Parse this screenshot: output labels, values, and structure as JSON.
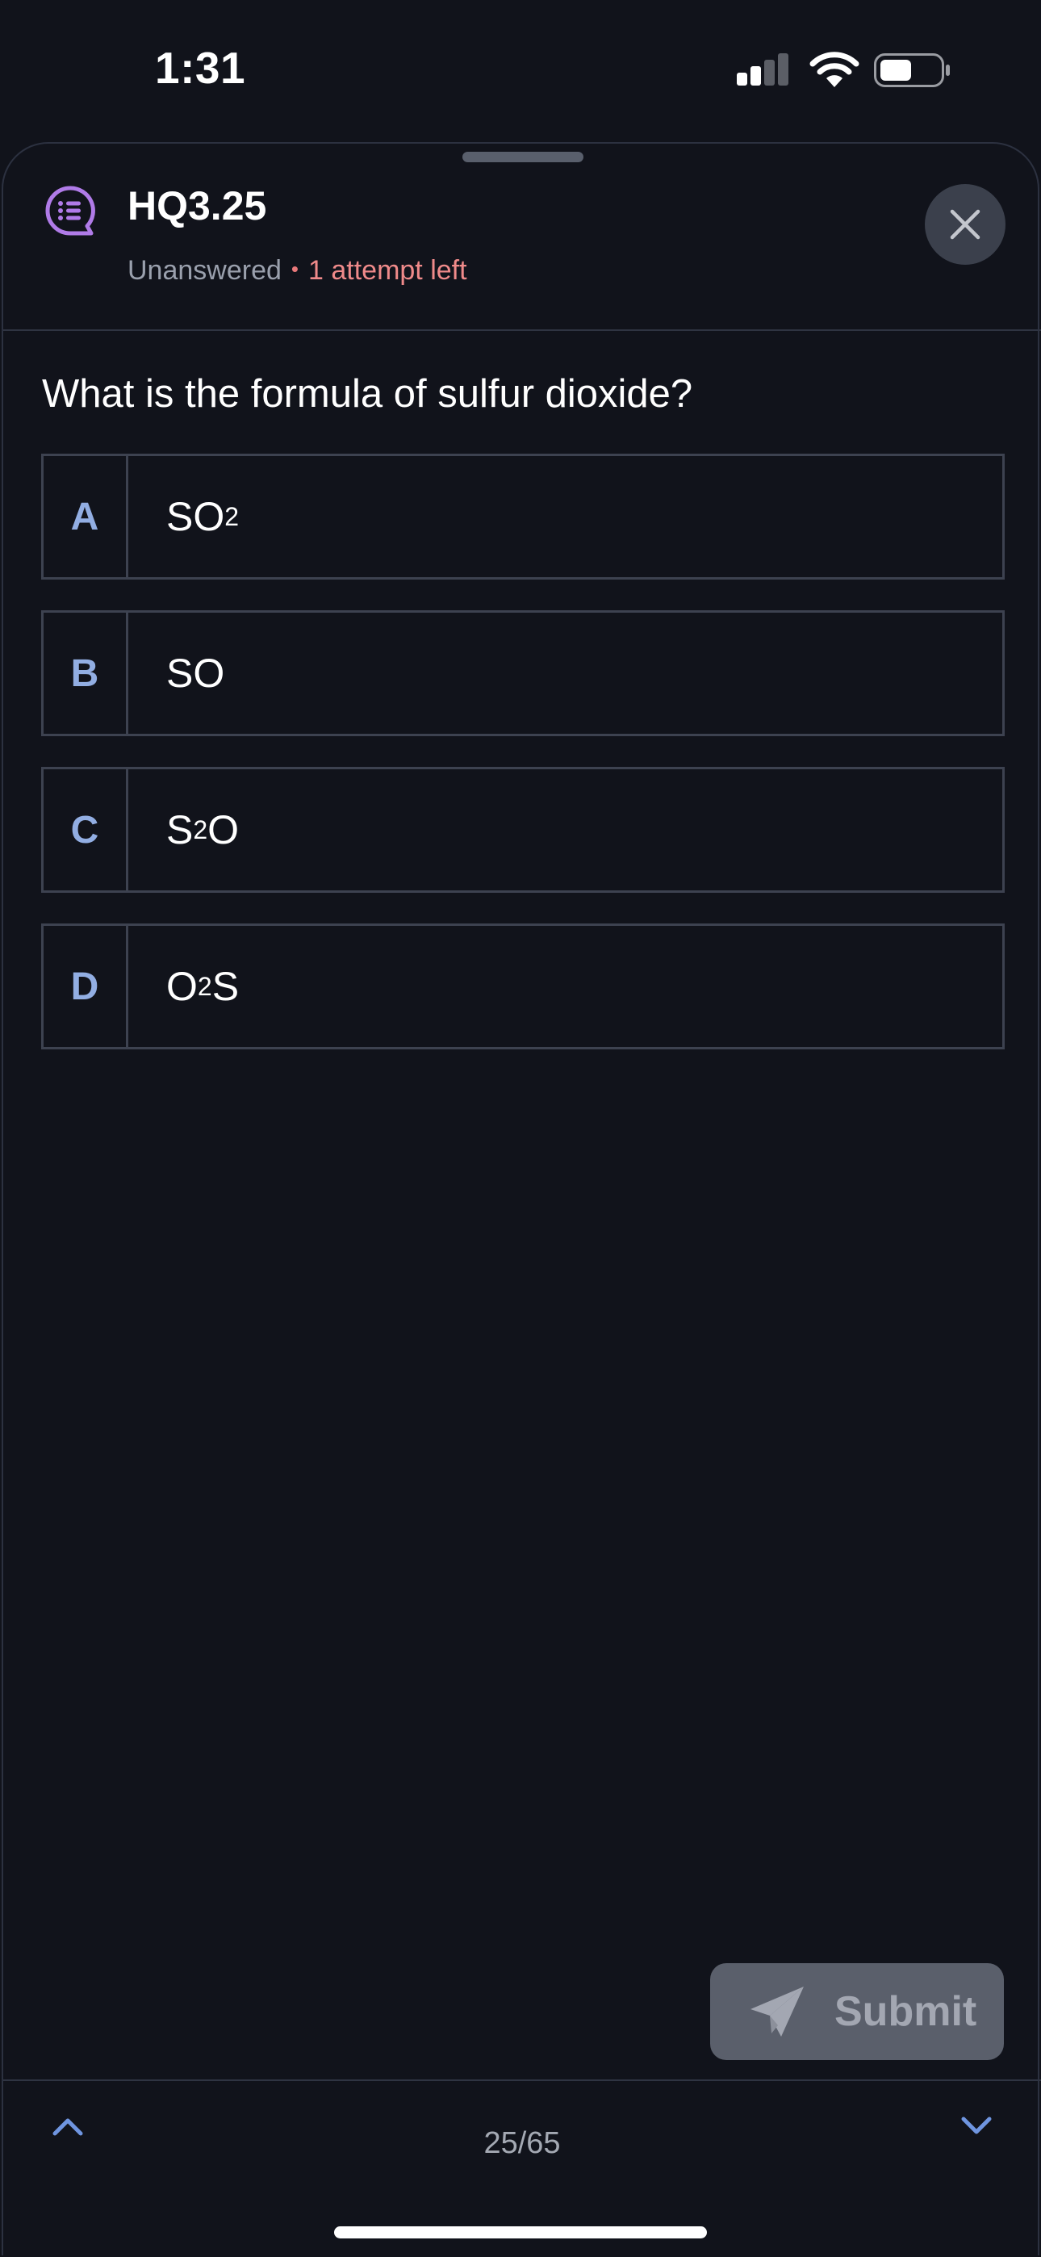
{
  "status_bar": {
    "time": "1:31"
  },
  "header": {
    "title": "HQ3.25",
    "status": "Unanswered",
    "separator": "•",
    "attempts": "1 attempt left"
  },
  "question": {
    "text": "What is the formula of sulfur dioxide?"
  },
  "options": [
    {
      "letter": "A",
      "parts": [
        "SO",
        "2",
        ""
      ]
    },
    {
      "letter": "B",
      "parts": [
        "SO",
        "",
        ""
      ]
    },
    {
      "letter": "C",
      "parts": [
        "S",
        "2",
        "O"
      ]
    },
    {
      "letter": "D",
      "parts": [
        "O",
        "2",
        "S"
      ]
    }
  ],
  "submit": {
    "label": "Submit"
  },
  "navigation": {
    "counter": "25/65"
  },
  "icons": {
    "quiz": "quiz-list-icon",
    "close": "close-icon",
    "submit": "paper-plane-icon",
    "previous": "chevron-up-icon",
    "next": "chevron-down-icon"
  },
  "colors": {
    "background": "#11131b",
    "accent_purple": "#b07be8",
    "option_letter": "#92aee3",
    "attempts_warning": "#ef8a8a",
    "nav_chevron": "#6f95e0"
  }
}
